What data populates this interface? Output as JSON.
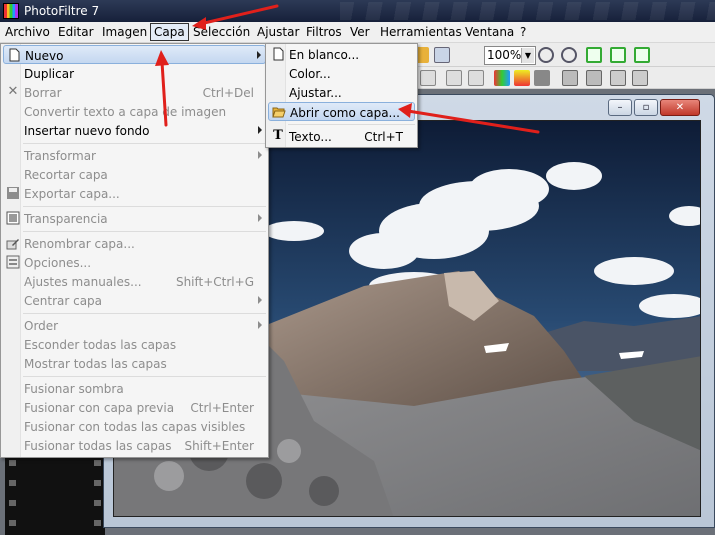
{
  "window": {
    "title": "PhotoFiltre 7"
  },
  "menubar": {
    "items": [
      "Archivo",
      "Editar",
      "Imagen",
      "Capa",
      "Selección",
      "Ajustar",
      "Filtros",
      "Ver",
      "Herramientas",
      "Ventana",
      "?"
    ]
  },
  "toolbar": {
    "zoom": "100%"
  },
  "capa_menu": {
    "nuevo": "Nuevo",
    "duplicar": "Duplicar",
    "borrar": "Borrar",
    "borrar_sc": "Ctrl+Del",
    "convertir": "Convertir texto a capa de imagen",
    "insertar_fondo": "Insertar nuevo fondo",
    "transformar": "Transformar",
    "recortar": "Recortar capa",
    "exportar": "Exportar capa...",
    "transparencia": "Transparencia",
    "renombrar": "Renombrar capa...",
    "opciones": "Opciones...",
    "ajustes_manuales": "Ajustes manuales...",
    "ajustes_manuales_sc": "Shift+Ctrl+G",
    "centrar": "Centrar capa",
    "order": "Order",
    "esconder": "Esconder todas las capas",
    "mostrar": "Mostrar todas las capas",
    "fusionar_sombra": "Fusionar sombra",
    "fusionar_previa": "Fusionar con capa previa",
    "fusionar_previa_sc": "Ctrl+Enter",
    "fusionar_visibles": "Fusionar con todas las capas visibles",
    "fusionar_todas": "Fusionar todas las capas",
    "fusionar_todas_sc": "Shift+Enter"
  },
  "nuevo_submenu": {
    "en_blanco": "En blanco...",
    "color": "Color...",
    "ajustar": "Ajustar...",
    "abrir_como_capa": "Abrir como capa...",
    "texto": "Texto...",
    "texto_sc": "Ctrl+T"
  },
  "image_window": {
    "min": "–",
    "max": "▫",
    "close": "✕"
  },
  "annotation_color": "#e0201b"
}
